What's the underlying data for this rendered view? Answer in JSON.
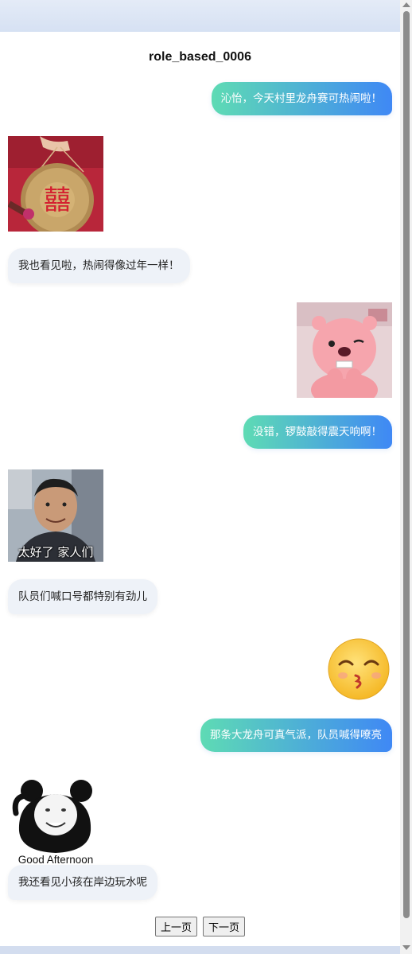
{
  "title": "role_based_0006",
  "messages": [
    {
      "side": "right",
      "type": "text",
      "text": "沁怡，今天村里龙舟赛可热闹啦！"
    },
    {
      "side": "left",
      "type": "image",
      "name": "gong-image"
    },
    {
      "side": "left",
      "type": "text",
      "text": "我也看见啦，热闹得像过年一样！"
    },
    {
      "side": "right",
      "type": "image",
      "name": "pink-beaver-image"
    },
    {
      "side": "right",
      "type": "text",
      "text": "没错，锣鼓敲得震天响啊！"
    },
    {
      "side": "left",
      "type": "image",
      "name": "man-selfie-image",
      "caption": "太好了 家人们"
    },
    {
      "side": "left",
      "type": "text",
      "text": "队员们喊口号都特别有劲儿"
    },
    {
      "side": "right",
      "type": "image",
      "name": "kissing-emoji-image"
    },
    {
      "side": "right",
      "type": "text",
      "text": "那条大龙舟可真气派，队员喊得嘹亮"
    },
    {
      "side": "left",
      "type": "image",
      "name": "panda-sticker-image",
      "caption": "Good Afternoon"
    },
    {
      "side": "left",
      "type": "text",
      "text": "我还看见小孩在岸边玩水呢"
    }
  ],
  "pager": {
    "prev": "上一页",
    "next": "下一页"
  },
  "colors": {
    "bubble_out_start": "#5edbb4",
    "bubble_out_end": "#3f88f5",
    "bubble_in": "#eef2f8"
  }
}
